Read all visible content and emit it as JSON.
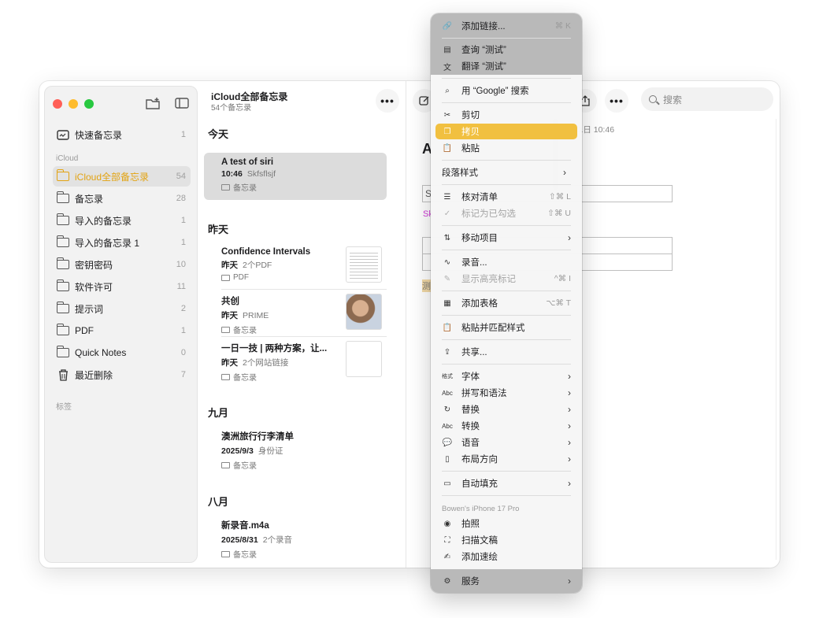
{
  "sidebar": {
    "section_icloud": "iCloud",
    "section_tags": "标签",
    "items": [
      {
        "label": "快速备忘录",
        "count": "1"
      },
      {
        "label": "iCloud全部备忘录",
        "count": "54"
      },
      {
        "label": "备忘录",
        "count": "28"
      },
      {
        "label": "导入的备忘录",
        "count": "1"
      },
      {
        "label": "导入的备忘录 1",
        "count": "1"
      },
      {
        "label": "密钥密码",
        "count": "10"
      },
      {
        "label": "软件许可",
        "count": "11"
      },
      {
        "label": "提示词",
        "count": "2"
      },
      {
        "label": "PDF",
        "count": "1"
      },
      {
        "label": "Quick Notes",
        "count": "0"
      },
      {
        "label": "最近删除",
        "count": "7"
      }
    ]
  },
  "list": {
    "title": "iCloud全部备忘录",
    "subtitle": "54个备忘录",
    "groups": [
      "今天",
      "昨天",
      "九月",
      "八月"
    ],
    "notes": [
      {
        "title": "A test of siri",
        "time": "10:46",
        "preview": "Skfsflsjf",
        "folder": "备忘录"
      },
      {
        "title": "Confidence Intervals",
        "time": "昨天",
        "preview": "2个PDF",
        "folder": "PDF"
      },
      {
        "title": "共创",
        "time": "昨天",
        "preview": "PRIME",
        "folder": "备忘录"
      },
      {
        "title": "一日一技 | 两种方案，让...",
        "time": "昨天",
        "preview": "2个网站链接",
        "folder": "备忘录"
      },
      {
        "title": "澳洲旅行行李清单",
        "time": "2025/9/3",
        "preview": "身份证",
        "folder": "备忘录"
      },
      {
        "title": "新录音.m4a",
        "time": "2025/8/31",
        "preview": "2个录音",
        "folder": "备忘录"
      }
    ]
  },
  "editor": {
    "date": "月1日 10:46",
    "title_fragment": "A",
    "search_placeholder": "搜索",
    "s_fragment": "S",
    "pink_fragment": "Sk",
    "ya_fragment": "测"
  },
  "menu": {
    "items": [
      {
        "icon": "link-icon",
        "label": "添加链接...",
        "shortcut": "⌘ K"
      },
      {
        "icon": "lookup-icon",
        "label": "查询 “测试”",
        "shortcut": ""
      },
      {
        "icon": "translate-icon",
        "label": "翻译 “测试”",
        "shortcut": ""
      },
      {
        "icon": "search-icon",
        "label": "用 “Google” 搜索",
        "shortcut": ""
      },
      {
        "icon": "scissors-icon",
        "label": "剪切",
        "shortcut": ""
      },
      {
        "icon": "copy-icon",
        "label": "拷贝",
        "shortcut": ""
      },
      {
        "icon": "paste-icon",
        "label": "粘贴",
        "shortcut": ""
      },
      {
        "icon": "",
        "label": "段落样式",
        "shortcut": "",
        "submenu": true
      },
      {
        "icon": "checklist-icon",
        "label": "核对清单",
        "shortcut": "⇧⌘ L"
      },
      {
        "icon": "checkmark-circle-icon",
        "label": "标记为已勾选",
        "shortcut": "⇧⌘ U",
        "disabled": true
      },
      {
        "icon": "move-icon",
        "label": "移动项目",
        "shortcut": "",
        "submenu": true
      },
      {
        "icon": "waveform-icon",
        "label": "录音...",
        "shortcut": ""
      },
      {
        "icon": "highlight-icon",
        "label": "显示高亮标记",
        "shortcut": "^⌘ I",
        "disabled": true
      },
      {
        "icon": "table-icon",
        "label": "添加表格",
        "shortcut": "⌥⌘ T"
      },
      {
        "icon": "paste-match-icon",
        "label": "粘贴并匹配样式",
        "shortcut": ""
      },
      {
        "icon": "share-icon",
        "label": "共享...",
        "shortcut": ""
      },
      {
        "icon": "font-icon",
        "label": "字体",
        "shortcut": "",
        "submenu": true
      },
      {
        "icon": "spelling-icon",
        "label": "拼写和语法",
        "shortcut": "",
        "submenu": true
      },
      {
        "icon": "replace-icon",
        "label": "替换",
        "shortcut": "",
        "submenu": true
      },
      {
        "icon": "transform-icon",
        "label": "转换",
        "shortcut": "",
        "submenu": true
      },
      {
        "icon": "speech-icon",
        "label": "语音",
        "shortcut": "",
        "submenu": true
      },
      {
        "icon": "layout-direction-icon",
        "label": "布局方向",
        "shortcut": "",
        "submenu": true
      },
      {
        "icon": "autofill-icon",
        "label": "自动填充",
        "shortcut": "",
        "submenu": true
      },
      {
        "icon": "camera-icon",
        "label": "拍照",
        "shortcut": ""
      },
      {
        "icon": "scan-icon",
        "label": "扫描文稿",
        "shortcut": ""
      },
      {
        "icon": "sketch-icon",
        "label": "添加速绘",
        "shortcut": ""
      },
      {
        "icon": "services-icon",
        "label": "服务",
        "shortcut": "",
        "submenu": true
      }
    ],
    "device_header": "Bowen's iPhone 17 Pro",
    "font_icon_text": "格式",
    "abc_text": "Abc"
  },
  "colors": {
    "accent": "#f1c040",
    "folder_active": "#e3a312"
  }
}
